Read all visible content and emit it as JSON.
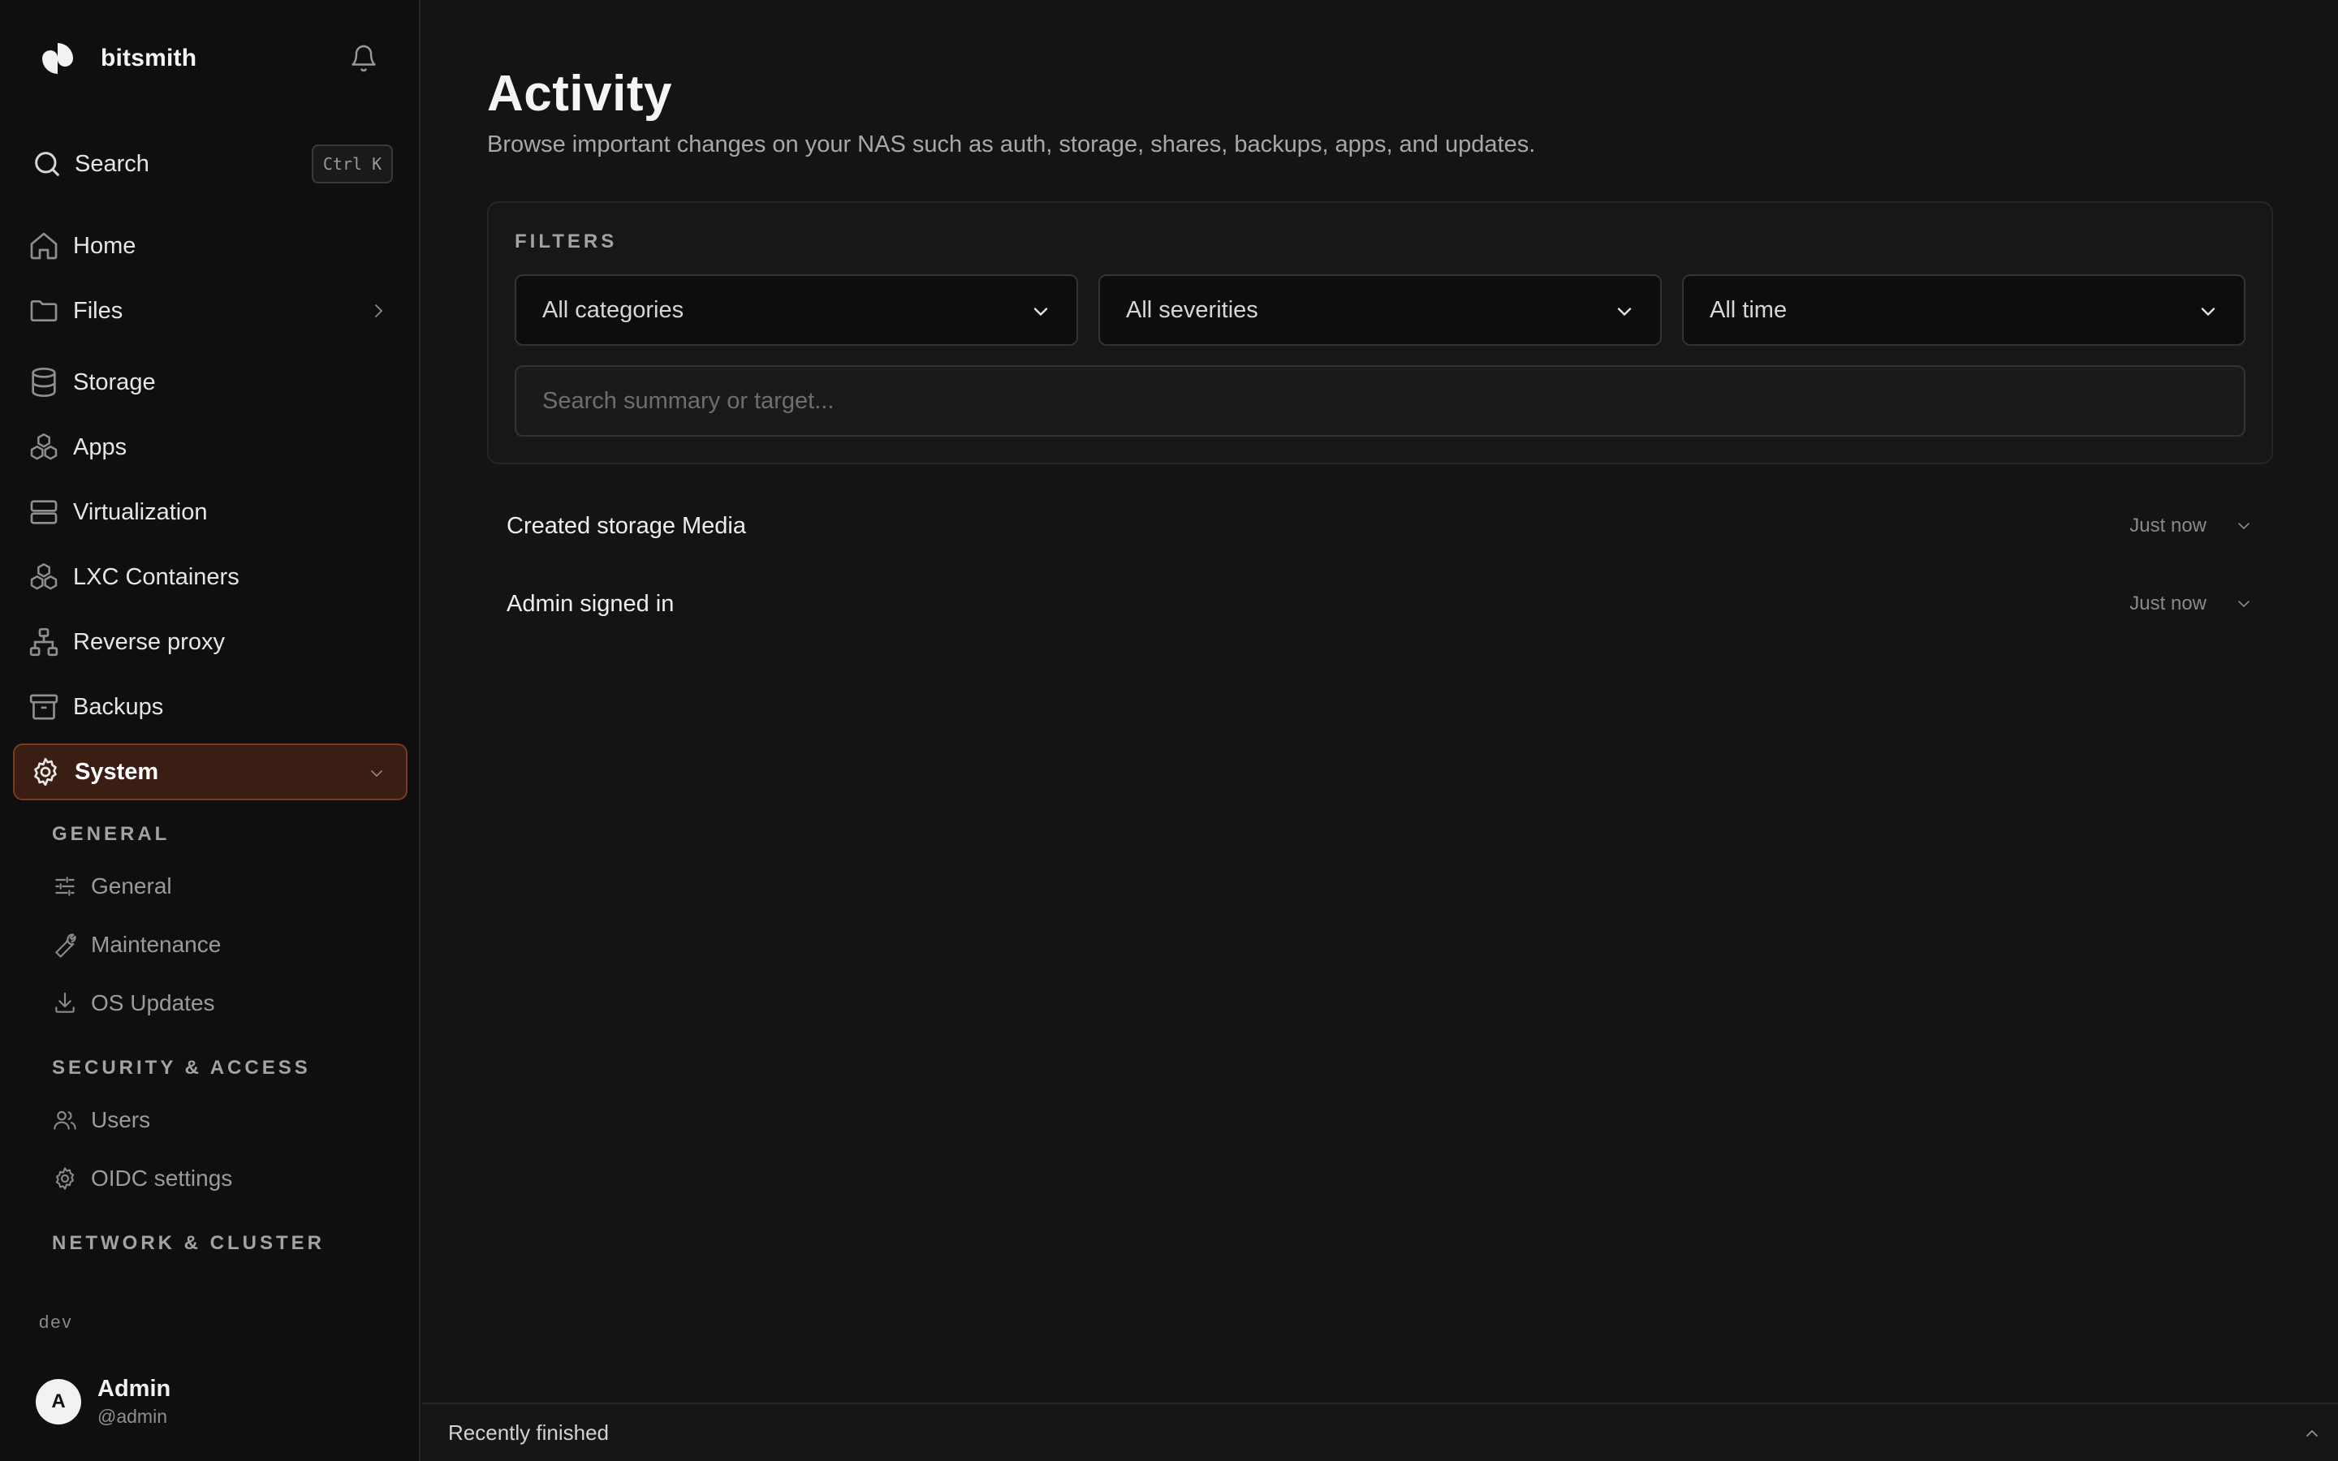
{
  "brand": {
    "name": "bitsmith",
    "logo_icon": "pinwheel-logo",
    "notification_icon": "bell-icon"
  },
  "sidebar": {
    "search": {
      "label": "Search",
      "shortcut": "Ctrl K"
    },
    "nav": [
      {
        "label": "Home",
        "icon": "home-icon"
      },
      {
        "label": "Files",
        "icon": "folder-icon"
      },
      {
        "label": "Storage",
        "icon": "database-icon"
      },
      {
        "label": "Apps",
        "icon": "boxes-icon"
      },
      {
        "label": "Virtualization",
        "icon": "server-icon"
      },
      {
        "label": "LXC Containers",
        "icon": "boxes-icon"
      },
      {
        "label": "Reverse proxy",
        "icon": "network-icon"
      },
      {
        "label": "Backups",
        "icon": "archive-icon"
      },
      {
        "label": "System",
        "icon": "gear-icon",
        "active": true
      }
    ],
    "system_sections": [
      {
        "title": "GENERAL",
        "items": [
          {
            "label": "General",
            "icon": "sliders-icon"
          },
          {
            "label": "Maintenance",
            "icon": "wrench-icon"
          },
          {
            "label": "OS Updates",
            "icon": "download-icon"
          }
        ]
      },
      {
        "title": "SECURITY & ACCESS",
        "items": [
          {
            "label": "Users",
            "icon": "users-icon"
          },
          {
            "label": "OIDC settings",
            "icon": "gear-icon"
          }
        ]
      },
      {
        "title": "NETWORK & CLUSTER",
        "items": []
      }
    ],
    "environment": "dev",
    "user": {
      "initial": "A",
      "name": "Admin",
      "handle": "@admin"
    }
  },
  "page": {
    "title": "Activity",
    "subtitle": "Browse important changes on your NAS such as auth, storage, shares, backups, apps, and updates.",
    "filters": {
      "label": "FILTERS",
      "category": "All categories",
      "severity": "All severities",
      "time": "All time",
      "search_placeholder": "Search summary or target..."
    },
    "activity": [
      {
        "summary": "Created storage Media",
        "time": "Just now"
      },
      {
        "summary": "Admin signed in",
        "time": "Just now"
      }
    ]
  },
  "bottom_bar": {
    "label": "Recently finished"
  },
  "colors": {
    "active_nav_bg": "#3a1e13",
    "active_nav_border": "#7a3a1f",
    "background": "#141414",
    "sidebar_bg": "#0f0f0f"
  }
}
